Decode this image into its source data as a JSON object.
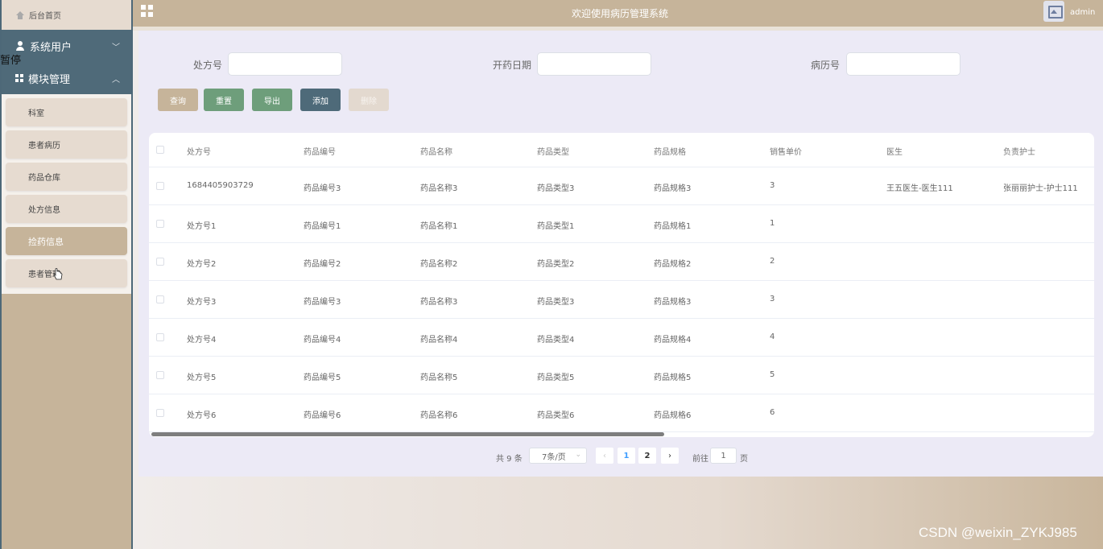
{
  "sidebar": {
    "home_label": "后台首页",
    "groups": [
      {
        "label": "系统用户",
        "chevron": "﹀"
      },
      {
        "label": "模块管理",
        "chevron": "︿"
      }
    ],
    "pause_overlay": "暂停",
    "items": [
      {
        "label": "科室"
      },
      {
        "label": "患者病历"
      },
      {
        "label": "药品仓库"
      },
      {
        "label": "处方信息"
      },
      {
        "label": "捡药信息"
      },
      {
        "label": "患者管理"
      }
    ]
  },
  "header": {
    "title": "欢迎使用病历管理系统",
    "user": "admin"
  },
  "filters": [
    {
      "label": "处方号",
      "value": ""
    },
    {
      "label": "开药日期",
      "value": ""
    },
    {
      "label": "病历号",
      "value": ""
    }
  ],
  "toolbar": {
    "query": "查询",
    "reset": "重置",
    "export": "导出",
    "add": "添加",
    "delete": "删除"
  },
  "table": {
    "columns": [
      "处方号",
      "药品编号",
      "药品名称",
      "药品类型",
      "药品规格",
      "销售单价",
      "医生",
      "负责护士"
    ],
    "rows": [
      [
        "1684405903729",
        "药品编号3",
        "药品名称3",
        "药品类型3",
        "药品规格3",
        "3",
        "王五医生-医生111",
        "张丽丽护士-护士111"
      ],
      [
        "处方号1",
        "药品编号1",
        "药品名称1",
        "药品类型1",
        "药品规格1",
        "1",
        "",
        ""
      ],
      [
        "处方号2",
        "药品编号2",
        "药品名称2",
        "药品类型2",
        "药品规格2",
        "2",
        "",
        ""
      ],
      [
        "处方号3",
        "药品编号3",
        "药品名称3",
        "药品类型3",
        "药品规格3",
        "3",
        "",
        ""
      ],
      [
        "处方号4",
        "药品编号4",
        "药品名称4",
        "药品类型4",
        "药品规格4",
        "4",
        "",
        ""
      ],
      [
        "处方号5",
        "药品编号5",
        "药品名称5",
        "药品类型5",
        "药品规格5",
        "5",
        "",
        ""
      ],
      [
        "处方号6",
        "药品编号6",
        "药品名称6",
        "药品类型6",
        "药品规格6",
        "6",
        "",
        ""
      ]
    ]
  },
  "pagination": {
    "total": "共 9 条",
    "page_size": "7条/页",
    "pages": [
      "1",
      "2"
    ],
    "current": "1",
    "goto_label": "前往",
    "goto_value": "1",
    "page_suffix": "页"
  },
  "watermark": "CSDN @weixin_ZYKJ985"
}
